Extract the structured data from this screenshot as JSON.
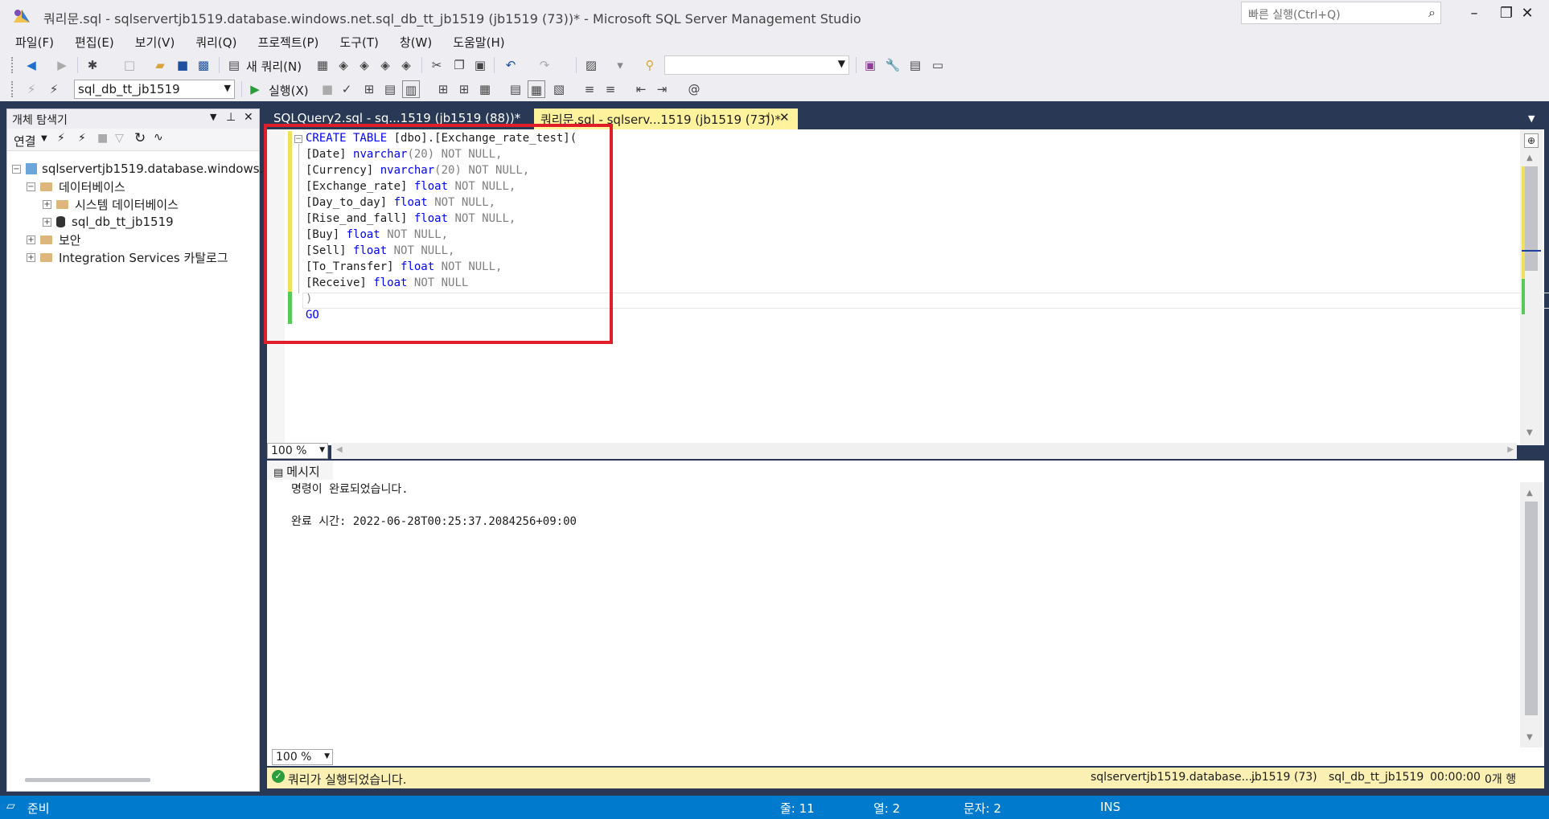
{
  "window": {
    "title": "쿼리문.sql - sqlservertjb1519.database.windows.net.sql_db_tt_jb1519 (jb1519 (73))* - Microsoft SQL Server Management Studio",
    "quick_launch_placeholder": "빠른 실행(Ctrl+Q)"
  },
  "menu": [
    "파일(F)",
    "편집(E)",
    "보기(V)",
    "쿼리(Q)",
    "프로젝트(P)",
    "도구(T)",
    "창(W)",
    "도움말(H)"
  ],
  "toolbar": {
    "new_query_label": "새 쿼리(N)",
    "database_selected": "sql_db_tt_jb1519",
    "execute_label": "실행(X)"
  },
  "object_explorer": {
    "title": "개체 탐색기",
    "connect_label": "연결",
    "tree": {
      "server": "sqlservertjb1519.database.windows.net",
      "databases": "데이터베이스",
      "system_databases": "시스템 데이터베이스",
      "user_db": "sql_db_tt_jb1519",
      "security": "보안",
      "integration": "Integration Services 카탈로그"
    }
  },
  "tabs": {
    "inactive": "SQLQuery2.sql - sq...1519 (jb1519 (88))*",
    "active": "쿼리문.sql - sqlserv...1519 (jb1519 (73))*"
  },
  "code": {
    "l1_kw": "CREATE TABLE",
    "l1_rest": " [dbo].[Exchange_rate_test](",
    "l2_col": "[Date]",
    "l2_type": "nvarchar",
    "l2_rest": "(20) NOT NULL,",
    "l3_col": "[Currency]",
    "l3_type": "nvarchar",
    "l3_rest": "(20) NOT NULL,",
    "l4_col": "[Exchange_rate]",
    "l4_type": "float",
    "l4_rest": "NOT NULL,",
    "l5_col": "[Day_to_day]",
    "l5_type": "float",
    "l5_rest": "NOT NULL,",
    "l6_col": "[Rise_and_fall]",
    "l6_type": "float",
    "l6_rest": "NOT NULL,",
    "l7_col": "[Buy]",
    "l7_type": "float",
    "l7_rest": "NOT NULL,",
    "l8_col": "[Sell]",
    "l8_type": "float",
    "l8_rest": "NOT NULL,",
    "l9_col": "[To_Transfer]",
    "l9_type": "float",
    "l9_rest": "NOT NULL,",
    "l10_col": "[Receive]",
    "l10_type": "float",
    "l10_rest": "NOT NULL",
    "l11": ")",
    "l12": "GO"
  },
  "zoom_editor": "100 %",
  "zoom_results": "100 %",
  "results": {
    "tab_label": "메시지",
    "line1": "명령이 완료되었습니다.",
    "line2": "완료 시간: 2022-06-28T00:25:37.2084256+09:00"
  },
  "query_status": {
    "message": "쿼리가 실행되었습니다.",
    "server": "sqlservertjb1519.database....",
    "user": "jb1519 (73)",
    "database": "sql_db_tt_jb1519",
    "elapsed": "00:00:00",
    "rows": "0개 행"
  },
  "statusbar": {
    "ready": "준비",
    "line": "줄: 11",
    "col": "열: 2",
    "ch": "문자: 2",
    "mode": "INS"
  },
  "colors": {
    "accent": "#007acc",
    "keyword": "#0000ff",
    "highlight_box": "#e01e2a",
    "tab_active": "#fff29d",
    "query_status_bg": "#fbf0b4"
  }
}
